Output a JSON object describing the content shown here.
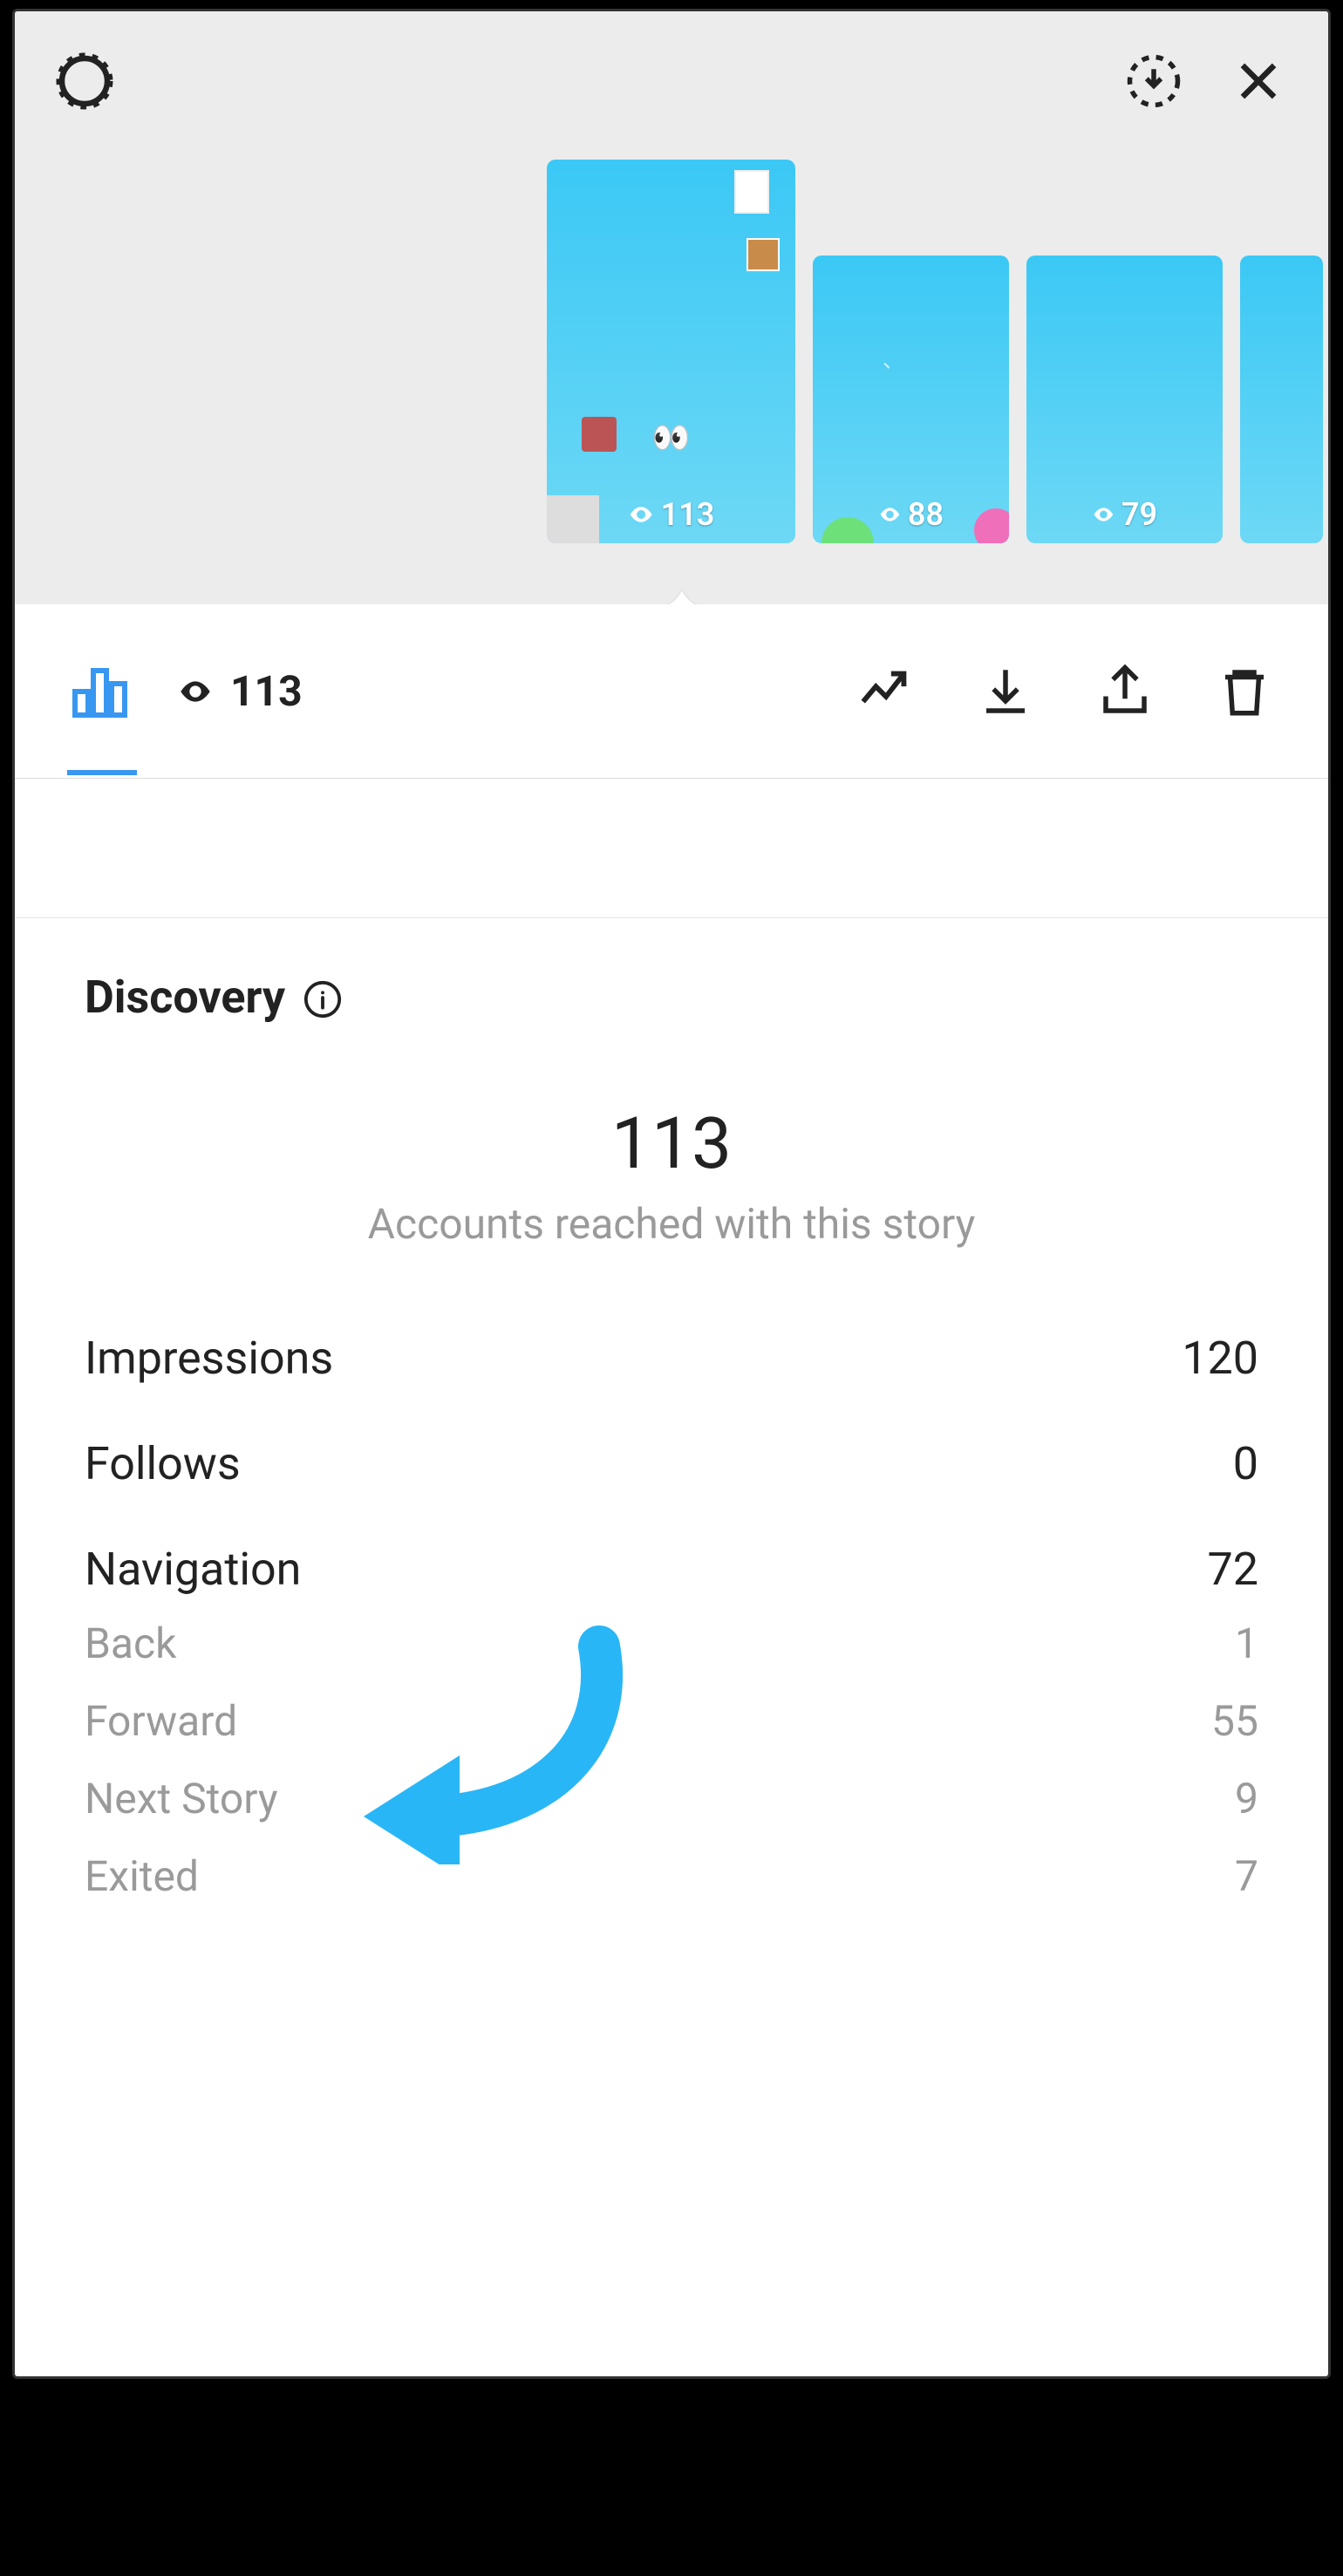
{
  "header": {
    "thumbnails": [
      {
        "views": "113",
        "type": "main"
      },
      {
        "views": "88",
        "type": "small"
      },
      {
        "views": "79",
        "type": "small"
      },
      {
        "views": "",
        "type": "tiny"
      }
    ]
  },
  "toolbar": {
    "view_count": "113"
  },
  "discovery": {
    "title": "Discovery",
    "reach_count": "113",
    "reach_caption": "Accounts reached with this story",
    "stats": {
      "impressions_label": "Impressions",
      "impressions_value": "120",
      "follows_label": "Follows",
      "follows_value": "0",
      "navigation_label": "Navigation",
      "navigation_value": "72",
      "items": [
        {
          "label": "Back",
          "value": "1"
        },
        {
          "label": "Forward",
          "value": "55"
        },
        {
          "label": "Next Story",
          "value": "9"
        },
        {
          "label": "Exited",
          "value": "7"
        }
      ]
    }
  },
  "icons": {
    "eyes": "👀"
  }
}
